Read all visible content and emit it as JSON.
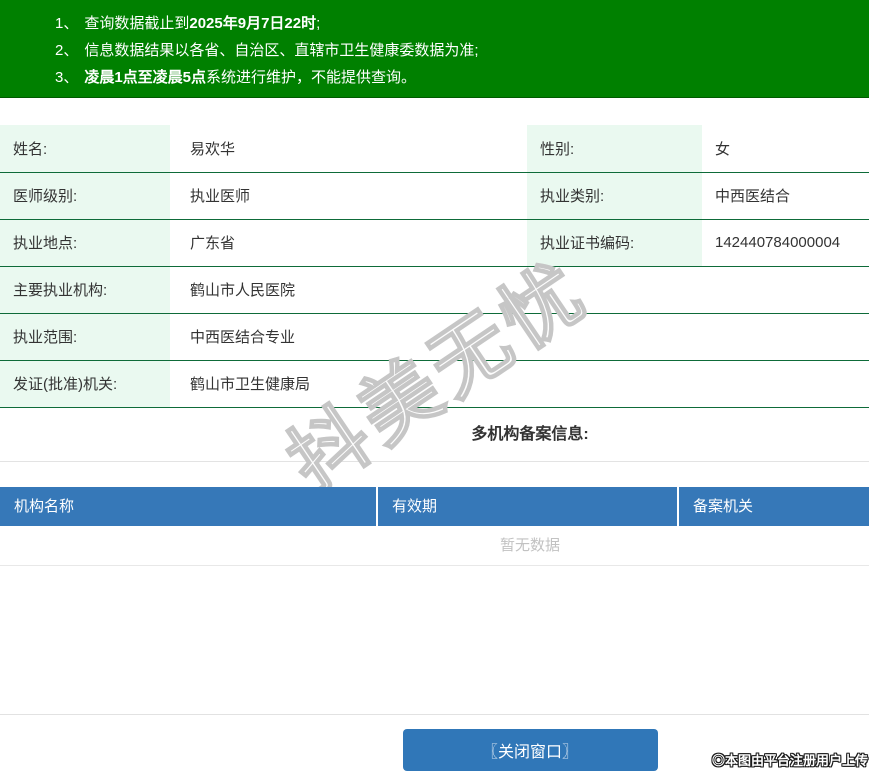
{
  "banner": {
    "items": [
      {
        "num": "1、",
        "pre": "查询数据截止到",
        "strong": "2025年9月7日22时",
        "post": ";"
      },
      {
        "num": "2、",
        "pre": "信息数据结果以各省、自治区、直辖市卫生健康委数据为准;",
        "strong": "",
        "post": ""
      },
      {
        "num": "3、",
        "pre": "",
        "strong": "凌晨1点至凌晨5点",
        "post": "系统进行维护，不能提供查询。"
      }
    ]
  },
  "profile": {
    "name_label": "姓名:",
    "name": "易欢华",
    "gender_label": "性别:",
    "gender": "女",
    "level_label": "医师级别:",
    "level": "执业医师",
    "category_label": "执业类别:",
    "category": "中西医结合",
    "location_label": "执业地点:",
    "location": "广东省",
    "cert_label": "执业证书编码:",
    "cert_number": "142440784000004",
    "org_label": "主要执业机构:",
    "org": "鹤山市人民医院",
    "scope_label": "执业范围:",
    "scope": "中西医结合专业",
    "issuer_label": "发证(批准)机关:",
    "issuer": "鹤山市卫生健康局"
  },
  "filing": {
    "title": "多机构备案信息:",
    "columns": [
      "机构名称",
      "有效期",
      "备案机关"
    ],
    "empty_text": "暂无数据"
  },
  "footer": {
    "close_button": "〖关闭窗口〗",
    "credit": "◎本图由平台注册用户上传"
  },
  "watermark": {
    "text": "抖美无忧"
  },
  "colors": {
    "banner_green": "#008000",
    "header_blue": "#3678b8",
    "button_blue": "#3077b8",
    "label_bg": "#eaf9f0",
    "row_border_green": "#0e6b39",
    "empty_text_gray": "#c2c2c2"
  }
}
